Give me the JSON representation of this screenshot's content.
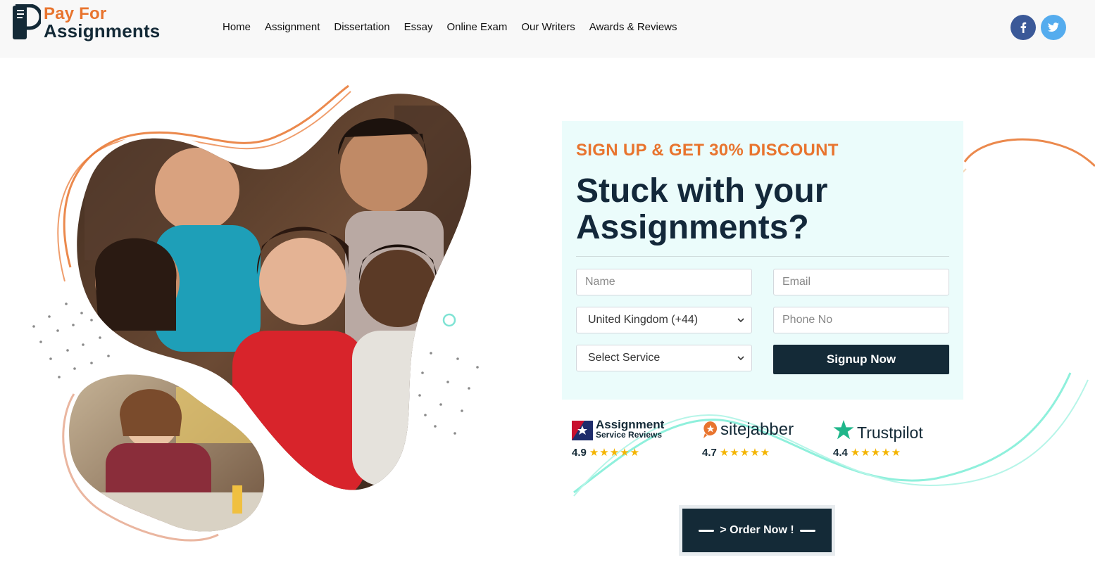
{
  "brand": {
    "line1": "Pay For",
    "line2": "Assignments"
  },
  "nav": {
    "items": [
      "Home",
      "Assignment",
      "Dissertation",
      "Essay",
      "Online Exam",
      "Our Writers",
      "Awards & Reviews"
    ]
  },
  "social": {
    "facebook": "f",
    "twitter": "t",
    "facebook_icon": "facebook-icon",
    "twitter_icon": "twitter-icon"
  },
  "form": {
    "kicker": "SIGN UP & GET 30% DISCOUNT",
    "title": "Stuck with your Assignments?",
    "name_placeholder": "Name",
    "email_placeholder": "Email",
    "country_selected": "United Kingdom (+44)",
    "phone_placeholder": "Phone No",
    "service_selected": "Select Service",
    "submit_label": "Signup Now"
  },
  "reviews": [
    {
      "name_line1": "Assignment",
      "name_line2": "Service Reviews",
      "rating": "4.9",
      "stars": "★★★★★"
    },
    {
      "name": "sitejabber",
      "rating": "4.7",
      "stars": "★★★★★"
    },
    {
      "name": "Trustpilot",
      "rating": "4.4",
      "stars": "★★★★★"
    }
  ],
  "order": {
    "label": "> Order Now !"
  },
  "colors": {
    "accent": "#e8742e",
    "dark": "#142a37",
    "mint": "#8ff0dc",
    "card_bg": "#ebfcfb",
    "facebook": "#3b5998",
    "twitter": "#55acee",
    "star": "#f4b400"
  }
}
